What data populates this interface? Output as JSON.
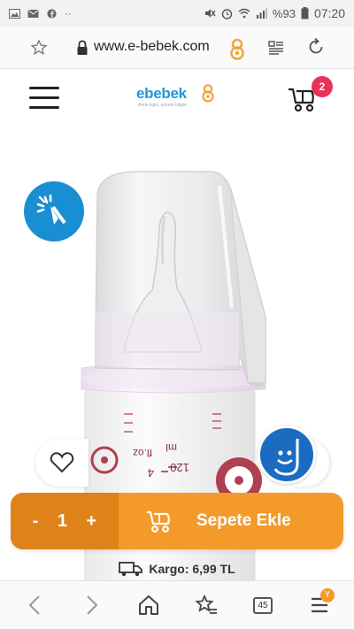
{
  "status_bar": {
    "battery": "%93",
    "time": "07:20"
  },
  "url_bar": {
    "url": "www.e-bebek.com"
  },
  "header": {
    "logo": "ebebek",
    "tagline": "Anne ilgisi, uzman bilgisi",
    "cart_count": "2"
  },
  "product": {
    "bottle_marks": [
      "ml",
      "fl.oz",
      "120",
      "4"
    ]
  },
  "cart_bar": {
    "minus": "-",
    "quantity": "1",
    "plus": "+",
    "add_label": "Sepete Ekle"
  },
  "shipping": {
    "text": "Kargo: 6,99 TL"
  },
  "browser_nav": {
    "tabs_count": "45",
    "menu_badge": "Y"
  },
  "colors": {
    "brand_blue": "#1a9ad6",
    "cart_orange": "#f39a2b",
    "qty_orange": "#e0821a",
    "badge_red": "#e8325a"
  }
}
